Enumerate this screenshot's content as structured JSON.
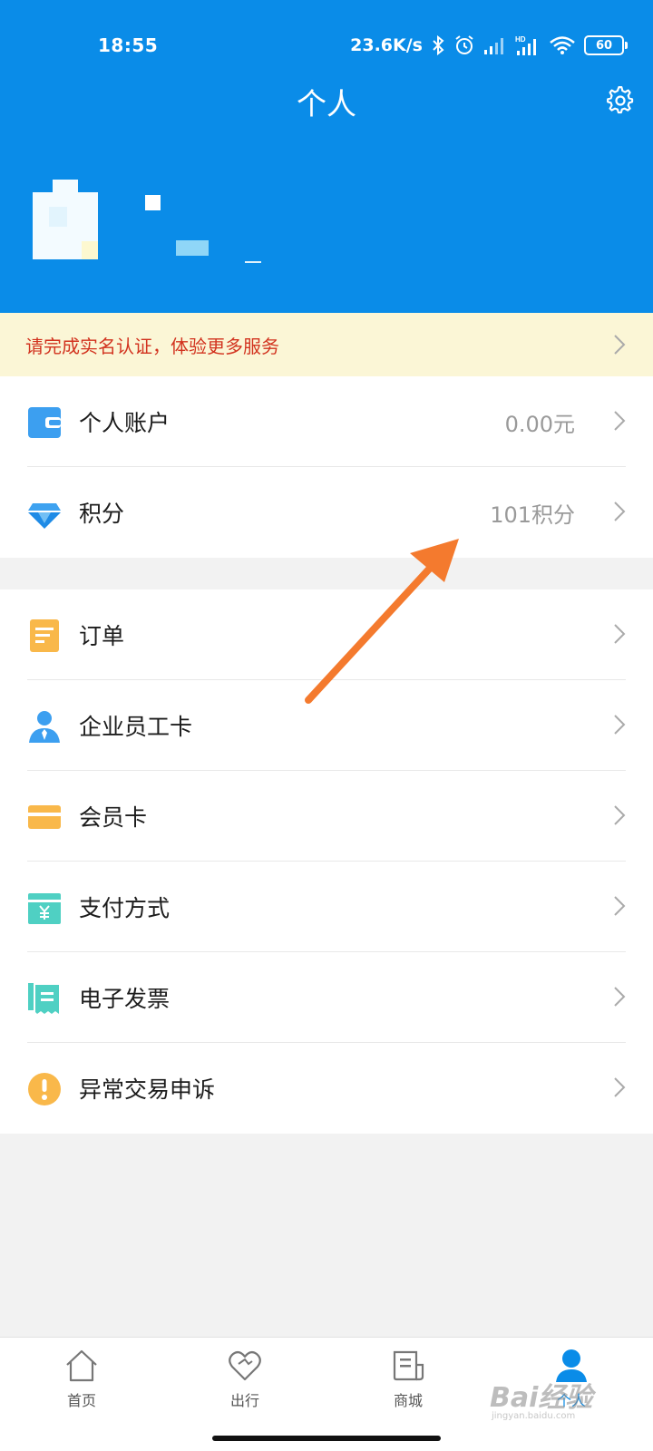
{
  "status_bar": {
    "time": "18:55",
    "net_speed": "23.6K/s",
    "battery": "60"
  },
  "header": {
    "title": "个人"
  },
  "notice": {
    "text": "请完成实名认证，体验更多服务"
  },
  "group1": [
    {
      "label": "个人账户",
      "value": "0.00元",
      "icon": "wallet-icon"
    },
    {
      "label": "积分",
      "value": "101积分",
      "icon": "diamond-icon"
    }
  ],
  "group2": [
    {
      "label": "订单",
      "icon": "order-icon"
    },
    {
      "label": "企业员工卡",
      "icon": "employee-icon"
    },
    {
      "label": "会员卡",
      "icon": "member-card-icon"
    },
    {
      "label": "支付方式",
      "icon": "payment-icon"
    },
    {
      "label": "电子发票",
      "icon": "invoice-icon"
    },
    {
      "label": "异常交易申诉",
      "icon": "warning-icon"
    }
  ],
  "tabbar": [
    {
      "label": "首页",
      "icon": "home-icon"
    },
    {
      "label": "出行",
      "icon": "heart-icon"
    },
    {
      "label": "商城",
      "icon": "mall-icon"
    },
    {
      "label": "个人",
      "icon": "person-icon"
    }
  ],
  "watermark": {
    "text": "Bai经验",
    "sub": "jingyan.baidu.com"
  },
  "colors": {
    "header_blue": "#0a8ce8",
    "notice_bg": "#fbf6d6",
    "notice_text": "#d2331f",
    "arrow": "#f47a2e"
  }
}
